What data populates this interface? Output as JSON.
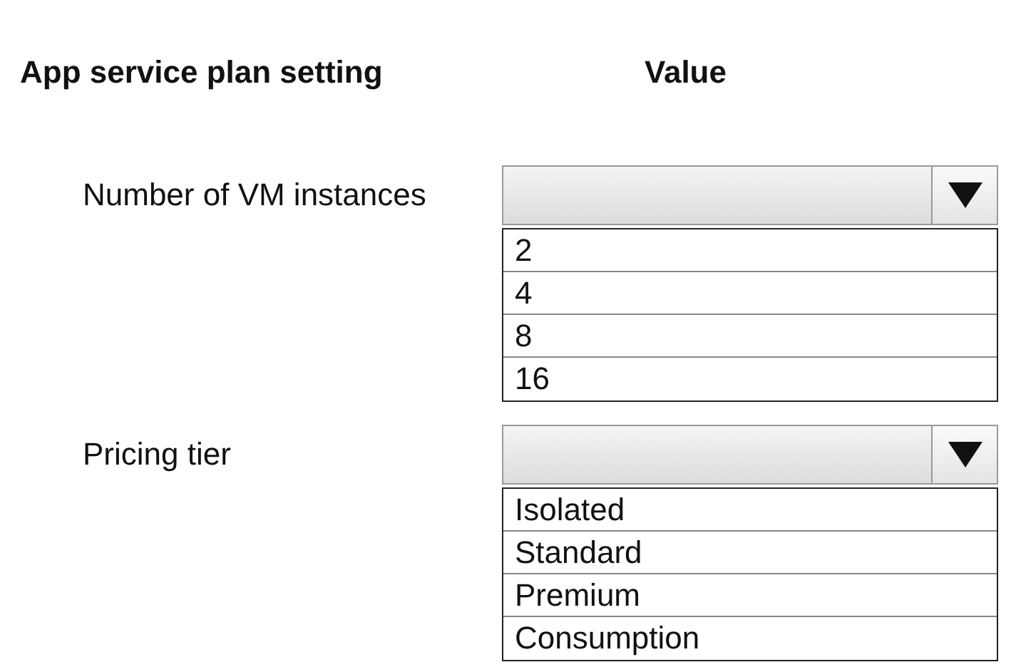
{
  "headers": [
    "App service plan setting",
    "Value"
  ],
  "settings": [
    {
      "label": "Number of VM instances",
      "options": [
        "2",
        "4",
        "8",
        "16"
      ]
    },
    {
      "label": "Pricing tier",
      "options": [
        "Isolated",
        "Standard",
        "Premium",
        "Consumption"
      ]
    }
  ]
}
